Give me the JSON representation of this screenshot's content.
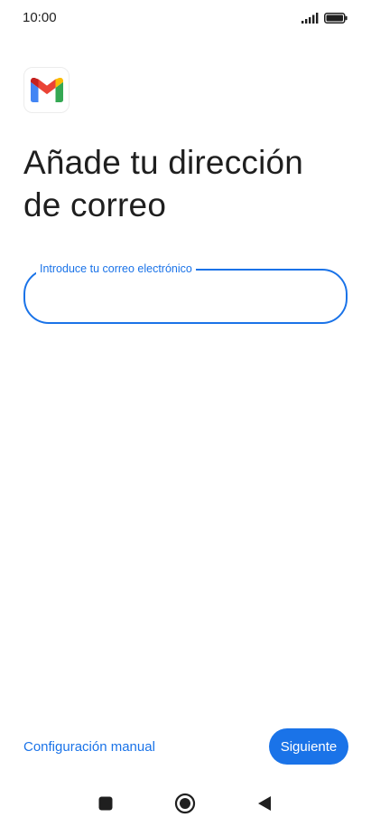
{
  "status_bar": {
    "time": "10:00",
    "icons": [
      "signal-icon",
      "battery-icon"
    ]
  },
  "logo": {
    "name": "gmail-logo",
    "colors": [
      "#4285f4",
      "#ea4335",
      "#fbbc04",
      "#34a853",
      "#c5221f"
    ]
  },
  "title_line1": "Añade tu dirección",
  "title_line2": "de correo",
  "email_field": {
    "label": "Introduce tu correo electrónico",
    "value": ""
  },
  "footer": {
    "manual_link": "Configuración manual",
    "next_button": "Siguiente"
  },
  "nav_bar": {
    "icons": [
      "recents-icon",
      "home-icon",
      "back-icon"
    ]
  },
  "colors": {
    "accent": "#1a73e8",
    "text": "#1f1f1f",
    "background": "#ffffff"
  }
}
